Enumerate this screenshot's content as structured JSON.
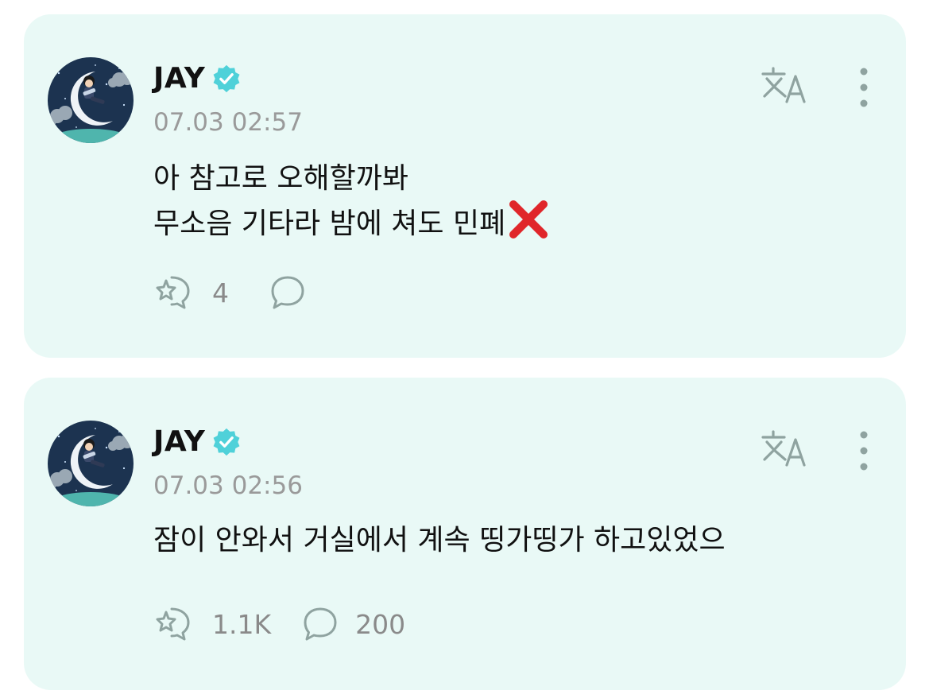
{
  "posts": [
    {
      "author": "JAY",
      "verified": true,
      "timestamp": "07.03 02:57",
      "lines": [
        "아 참고로 오해할까봐",
        "무소음 기타라 밤에 쳐도 민폐"
      ],
      "trailing_emoji": "cross-mark-icon",
      "like_count": "4",
      "comment_count": ""
    },
    {
      "author": "JAY",
      "verified": true,
      "timestamp": "07.03 02:56",
      "lines": [
        "잠이 안와서 거실에서 계속 띵가띵가 하고있었으"
      ],
      "like_count": "1.1K",
      "comment_count": "200"
    }
  ],
  "icons": {
    "like": "bubble-star-icon",
    "comment": "comment-bubble-icon",
    "translate": "translate-icon",
    "more": "more-vertical-icon",
    "verified": "verified-badge-icon"
  },
  "colors": {
    "card_background": "#e9f9f6",
    "accent": "#4fd1d9",
    "icon_gray": "#8fa3a0",
    "cross_red": "#e0262a"
  }
}
